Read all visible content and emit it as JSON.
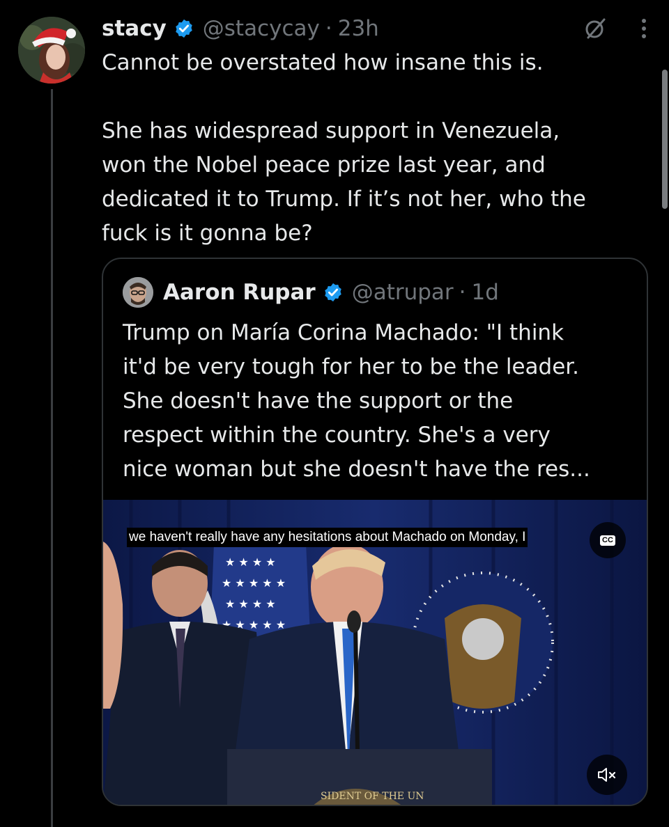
{
  "tweet": {
    "author_name": "stacy",
    "author_handle": "@stacycay",
    "separator": "·",
    "time": "23h",
    "text_line1": "Cannot be overstated how insane this is.",
    "text_line2": "She has widespread support in Venezuela,\nwon the Nobel peace prize last year, and\ndedicated it to Trump. If it’s not her, who the\nfuck is it gonna be?",
    "verified": true,
    "accent_color": "#1d9bf0",
    "icons": [
      "grok-icon",
      "more-options-icon"
    ]
  },
  "quote": {
    "author_name": "Aaron Rupar",
    "author_handle": "@atrupar",
    "separator": "·",
    "time": "1d",
    "verified": true,
    "text": "Trump on María Corina Machado: \"I think\nit'd be very tough for her to be the leader.\nShe doesn't have the support or the\nrespect within the country. She's a very\nnice woman but she doesn't have the res...",
    "video": {
      "caption": "we haven't really have any hesitations about Machado on Monday, I",
      "cc_label": "CC",
      "muted": true,
      "seal_text": "SIDENT OF THE UN"
    }
  }
}
